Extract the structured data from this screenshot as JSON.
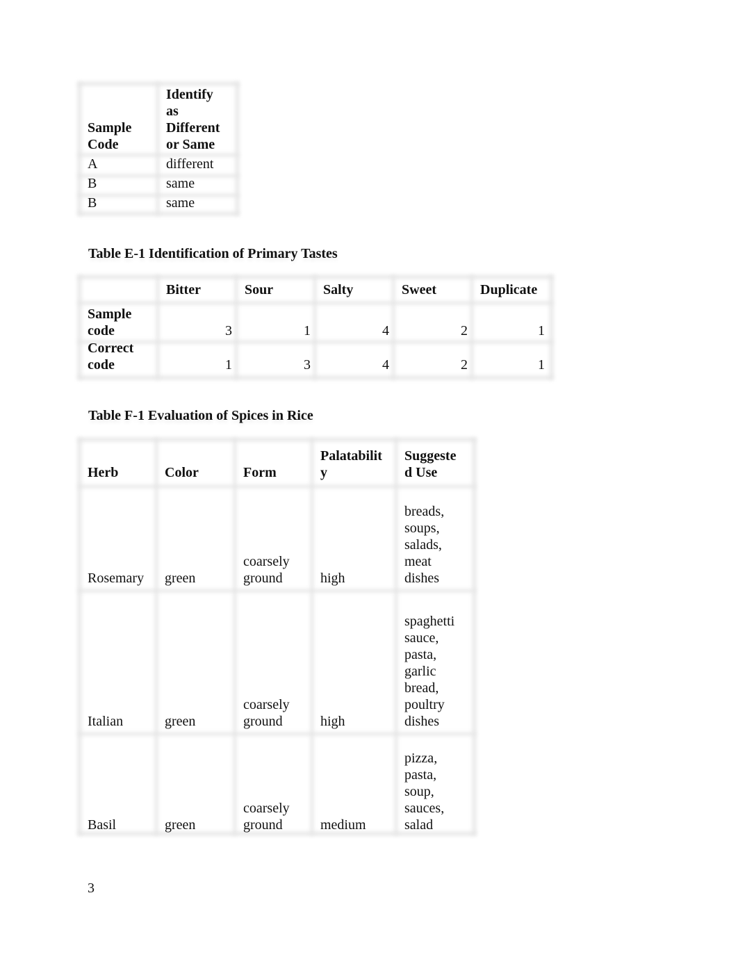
{
  "table_d": {
    "headers": [
      "Sample Code",
      "Identify as Different or Same"
    ],
    "header_lines": [
      [
        "Sample",
        "Code"
      ],
      [
        "Identify",
        "as",
        "Different",
        "or Same"
      ]
    ],
    "rows": [
      [
        "A",
        "different"
      ],
      [
        "B",
        "same"
      ],
      [
        "B",
        "same"
      ]
    ]
  },
  "table_e": {
    "title": "Table E-1 Identification of Primary Tastes",
    "headers": [
      "",
      "Bitter",
      "Sour",
      "Salty",
      "Sweet",
      "Duplicate"
    ],
    "rows": [
      {
        "label_lines": [
          "Sample",
          "code"
        ],
        "values": [
          "3",
          "1",
          "4",
          "2",
          "1"
        ]
      },
      {
        "label_lines": [
          "Correct",
          "code"
        ],
        "values": [
          "1",
          "3",
          "4",
          "2",
          "1"
        ]
      }
    ]
  },
  "table_f": {
    "title": "Table F-1 Evaluation of Spices in Rice",
    "headers": [
      "Herb",
      "Color",
      "Form",
      "Palatability",
      "Suggested Use"
    ],
    "header_lines": [
      [
        "Herb"
      ],
      [
        "Color"
      ],
      [
        "Form"
      ],
      [
        "Palatabilit",
        "y"
      ],
      [
        "Suggeste",
        "d Use"
      ]
    ],
    "rows": [
      {
        "herb": "Rosemary",
        "color": "green",
        "form_lines": [
          "coarsely",
          "ground"
        ],
        "palatability": "high",
        "use_lines": [
          "breads,",
          "soups,",
          "salads,",
          "meat",
          "dishes"
        ]
      },
      {
        "herb": "Italian",
        "color": "green",
        "form_lines": [
          "coarsely",
          "ground"
        ],
        "palatability": "high",
        "use_lines": [
          "spaghetti",
          "sauce,",
          "pasta,",
          "garlic",
          "bread,",
          "poultry",
          "dishes"
        ]
      },
      {
        "herb": "Basil",
        "color": "green",
        "form_lines": [
          "coarsely",
          "ground"
        ],
        "palatability": "medium",
        "use_lines": [
          "pizza,",
          "pasta,",
          "soup,",
          "sauces,",
          "salad"
        ]
      }
    ]
  },
  "page_number": "3"
}
